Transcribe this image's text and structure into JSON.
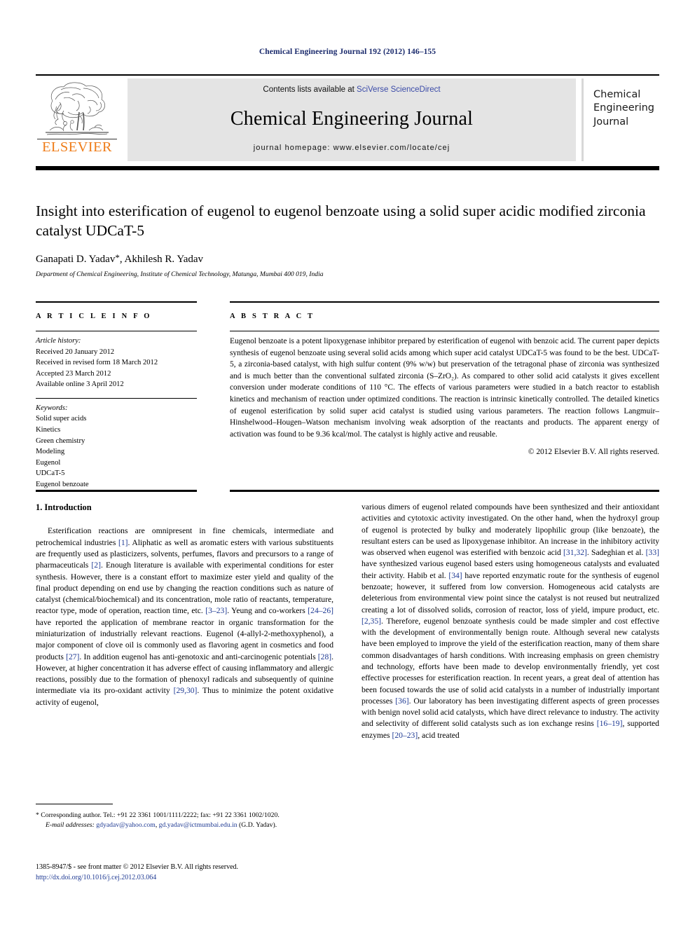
{
  "running_head": "Chemical Engineering Journal 192 (2012) 146–155",
  "masthead": {
    "logo_wordmark": "ELSEVIER",
    "contents_prefix": "Contents lists available at ",
    "contents_link": "SciVerse ScienceDirect",
    "journal_title": "Chemical Engineering Journal",
    "homepage_line": "journal homepage: www.elsevier.com/locate/cej",
    "cover_line1": "Chemical",
    "cover_line2": "Engineering",
    "cover_line3": "Journal",
    "accent_orange": "#ef7d1a",
    "link_blue": "#3b4ba8",
    "banner_gray": "#e4e4e4"
  },
  "article": {
    "title": "Insight into esterification of eugenol to eugenol benzoate using a solid super acidic modified zirconia catalyst UDCaT-5",
    "authors": "Ganapati D. Yadav",
    "authors_tail": ", Akhilesh R. Yadav",
    "corresponding_mark": "*",
    "affiliation": "Department of Chemical Engineering, Institute of Chemical Technology, Matunga, Mumbai 400 019, India"
  },
  "article_info": {
    "heading": "A R T I C L E   I N F O",
    "history_label": "Article history:",
    "history": [
      "Received 20 January 2012",
      "Received in revised form 18 March 2012",
      "Accepted 23 March 2012",
      "Available online 3 April 2012"
    ],
    "keywords_label": "Keywords:",
    "keywords": [
      "Solid super acids",
      "Kinetics",
      "Green chemistry",
      "Modeling",
      "Eugenol",
      "UDCaT-5",
      "Eugenol benzoate"
    ]
  },
  "abstract": {
    "heading": "A B S T R A C T",
    "text": "Eugenol benzoate is a potent lipoxygenase inhibitor prepared by esterification of eugenol with benzoic acid. The current paper depicts synthesis of eugenol benzoate using several solid acids among which super acid catalyst UDCaT-5 was found to be the best. UDCaT-5, a zirconia-based catalyst, with high sulfur content (9% w/w) but preservation of the tetragonal phase of zirconia was synthesized and is much better than the conventional sulfated zirconia (S–ZrO₂). As compared to other solid acid catalysts it gives excellent conversion under moderate conditions of 110 °C. The effects of various parameters were studied in a batch reactor to establish kinetics and mechanism of reaction under optimized conditions. The reaction is intrinsic kinetically controlled. The detailed kinetics of eugenol esterification by solid super acid catalyst is studied using various parameters. The reaction follows Langmuir–Hinshelwood–Hougen–Watson mechanism involving weak adsorption of the reactants and products. The apparent energy of activation was found to be 9.36 kcal/mol. The catalyst is highly active and reusable.",
    "copyright": "© 2012 Elsevier B.V. All rights reserved."
  },
  "introduction": {
    "heading": "1. Introduction",
    "left_paragraph": "Esterification reactions are omnipresent in fine chemicals, intermediate and petrochemical industries [1]. Aliphatic as well as aromatic esters with various substituents are frequently used as plasticizers, solvents, perfumes, flavors and precursors to a range of pharmaceuticals [2]. Enough literature is available with experimental conditions for ester synthesis. However, there is a constant effort to maximize ester yield and quality of the final product depending on end use by changing the reaction conditions such as nature of catalyst (chemical/biochemical) and its concentration, mole ratio of reactants, temperature, reactor type, mode of operation, reaction time, etc. [3–23]. Yeung and co-workers [24–26] have reported the application of membrane reactor in organic transformation for the miniaturization of industrially relevant reactions. Eugenol (4-allyl-2-methoxyphenol), a major component of clove oil is commonly used as flavoring agent in cosmetics and food products [27]. In addition eugenol has anti-genotoxic and anti-carcinogenic potentials [28]. However, at higher concentration it has adverse effect of causing inflammatory and allergic reactions, possibly due to the formation of phenoxyl radicals and subsequently of quinine intermediate via its pro-oxidant activity [29,30]. Thus to minimize the potent oxidative activity of eugenol,",
    "right_paragraph": "various dimers of eugenol related compounds have been synthesized and their antioxidant activities and cytotoxic activity investigated. On the other hand, when the hydroxyl group of eugenol is protected by bulky and moderately lipophilic group (like benzoate), the resultant esters can be used as lipoxygenase inhibitor. An increase in the inhibitory activity was observed when eugenol was esterified with benzoic acid [31,32]. Sadeghian et al. [33] have synthesized various eugenol based esters using homogeneous catalysts and evaluated their activity. Habib et al. [34] have reported enzymatic route for the synthesis of eugenol benzoate; however, it suffered from low conversion. Homogeneous acid catalysts are deleterious from environmental view point since the catalyst is not reused but neutralized creating a lot of dissolved solids, corrosion of reactor, loss of yield, impure product, etc. [2,35]. Therefore, eugenol benzoate synthesis could be made simpler and cost effective with the development of environmentally benign route. Although several new catalysts have been employed to improve the yield of the esterification reaction, many of them share common disadvantages of harsh conditions. With increasing emphasis on green chemistry and technology, efforts have been made to develop environmentally friendly, yet cost effective processes for esterification reaction. In recent years, a great deal of attention has been focused towards the use of solid acid catalysts in a number of industrially important processes [36]. Our laboratory has been investigating different aspects of green processes with benign novel solid acid catalysts, which have direct relevance to industry. The activity and selectivity of different solid catalysts such as ion exchange resins [16–19], supported enzymes [20–23], acid treated"
  },
  "footnote": {
    "corresponding": "* Corresponding author. Tel.: +91 22 3361 1001/1111/2222; fax: +91 22 3361 1002/1020.",
    "email_label": "E-mail addresses:",
    "email1": "gdyadav@yahoo.com",
    "email_sep": ", ",
    "email2": "gd.yadav@ictmumbai.edu.in",
    "email_tail": " (G.D. Yadav).",
    "issn_line": "1385-8947/$ - see front matter © 2012 Elsevier B.V. All rights reserved.",
    "doi": "http://dx.doi.org/10.1016/j.cej.2012.03.064"
  }
}
